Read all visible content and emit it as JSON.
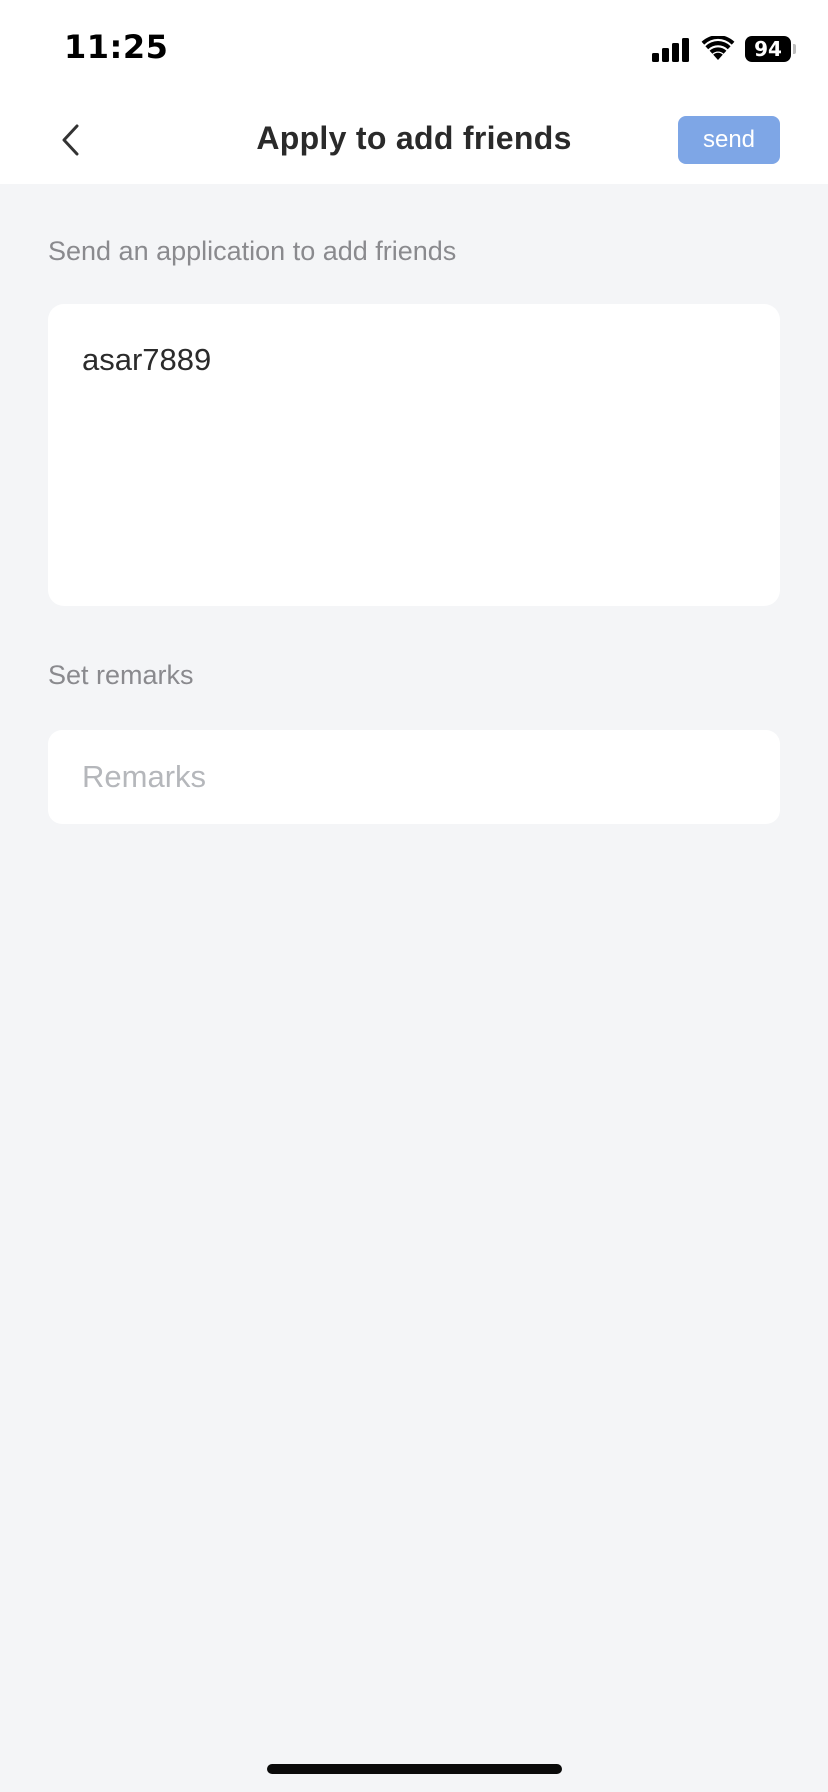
{
  "status_bar": {
    "time": "11:25",
    "battery": "94",
    "icons": [
      "signal-icon",
      "wifi-icon",
      "battery-icon"
    ]
  },
  "nav": {
    "back_icon": "chevron-left-icon",
    "title": "Apply to add friends",
    "send_label": "send",
    "send_color": "#7ea6e6"
  },
  "application": {
    "label": "Send an application to add friends",
    "message": "asar7889"
  },
  "remarks": {
    "label": "Set remarks",
    "placeholder": "Remarks",
    "value": ""
  },
  "colors": {
    "background": "#f4f5f7",
    "card": "#ffffff",
    "label": "#8a8a8e",
    "text": "#2b2b2b",
    "placeholder": "#b5b7bb"
  }
}
